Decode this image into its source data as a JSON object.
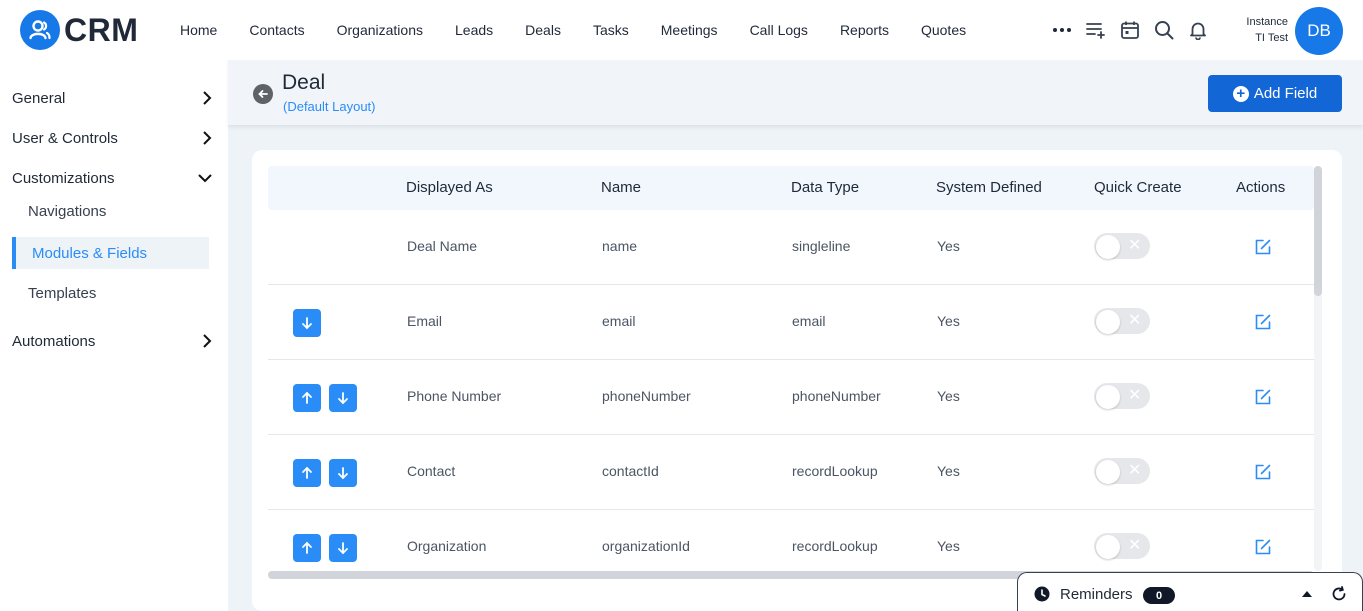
{
  "app": {
    "name": "CRM"
  },
  "nav": {
    "items": [
      "Home",
      "Contacts",
      "Organizations",
      "Leads",
      "Deals",
      "Tasks",
      "Meetings",
      "Call Logs",
      "Reports",
      "Quotes"
    ]
  },
  "topbar": {
    "instance_line1": "Instance",
    "instance_line2": "TI Test",
    "avatar_initials": "DB"
  },
  "sidebar": {
    "general": "General",
    "user_controls": "User & Controls",
    "customizations": "Customizations",
    "navigations": "Navigations",
    "modules_fields": "Modules & Fields",
    "templates": "Templates",
    "automations": "Automations"
  },
  "header": {
    "title": "Deal",
    "subtitle": "(Default Layout)",
    "add_field_label": "Add Field"
  },
  "table": {
    "columns": [
      "Displayed As",
      "Name",
      "Data Type",
      "System Defined",
      "Quick Create",
      "Actions"
    ],
    "rows": [
      {
        "displayed_as": "Deal Name",
        "name": "name",
        "data_type": "singleline",
        "system_defined": "Yes",
        "quick_create": false
      },
      {
        "displayed_as": "Email",
        "name": "email",
        "data_type": "email",
        "system_defined": "Yes",
        "quick_create": false
      },
      {
        "displayed_as": "Phone Number",
        "name": "phoneNumber",
        "data_type": "phoneNumber",
        "system_defined": "Yes",
        "quick_create": false
      },
      {
        "displayed_as": "Contact",
        "name": "contactId",
        "data_type": "recordLookup",
        "system_defined": "Yes",
        "quick_create": false
      },
      {
        "displayed_as": "Organization",
        "name": "organizationId",
        "data_type": "recordLookup",
        "system_defined": "Yes",
        "quick_create": false
      }
    ]
  },
  "reminders": {
    "label": "Reminders",
    "count": "0"
  },
  "colors": {
    "primary": "#1778e8",
    "accent": "#2a8cf7",
    "button": "#1366d6"
  }
}
